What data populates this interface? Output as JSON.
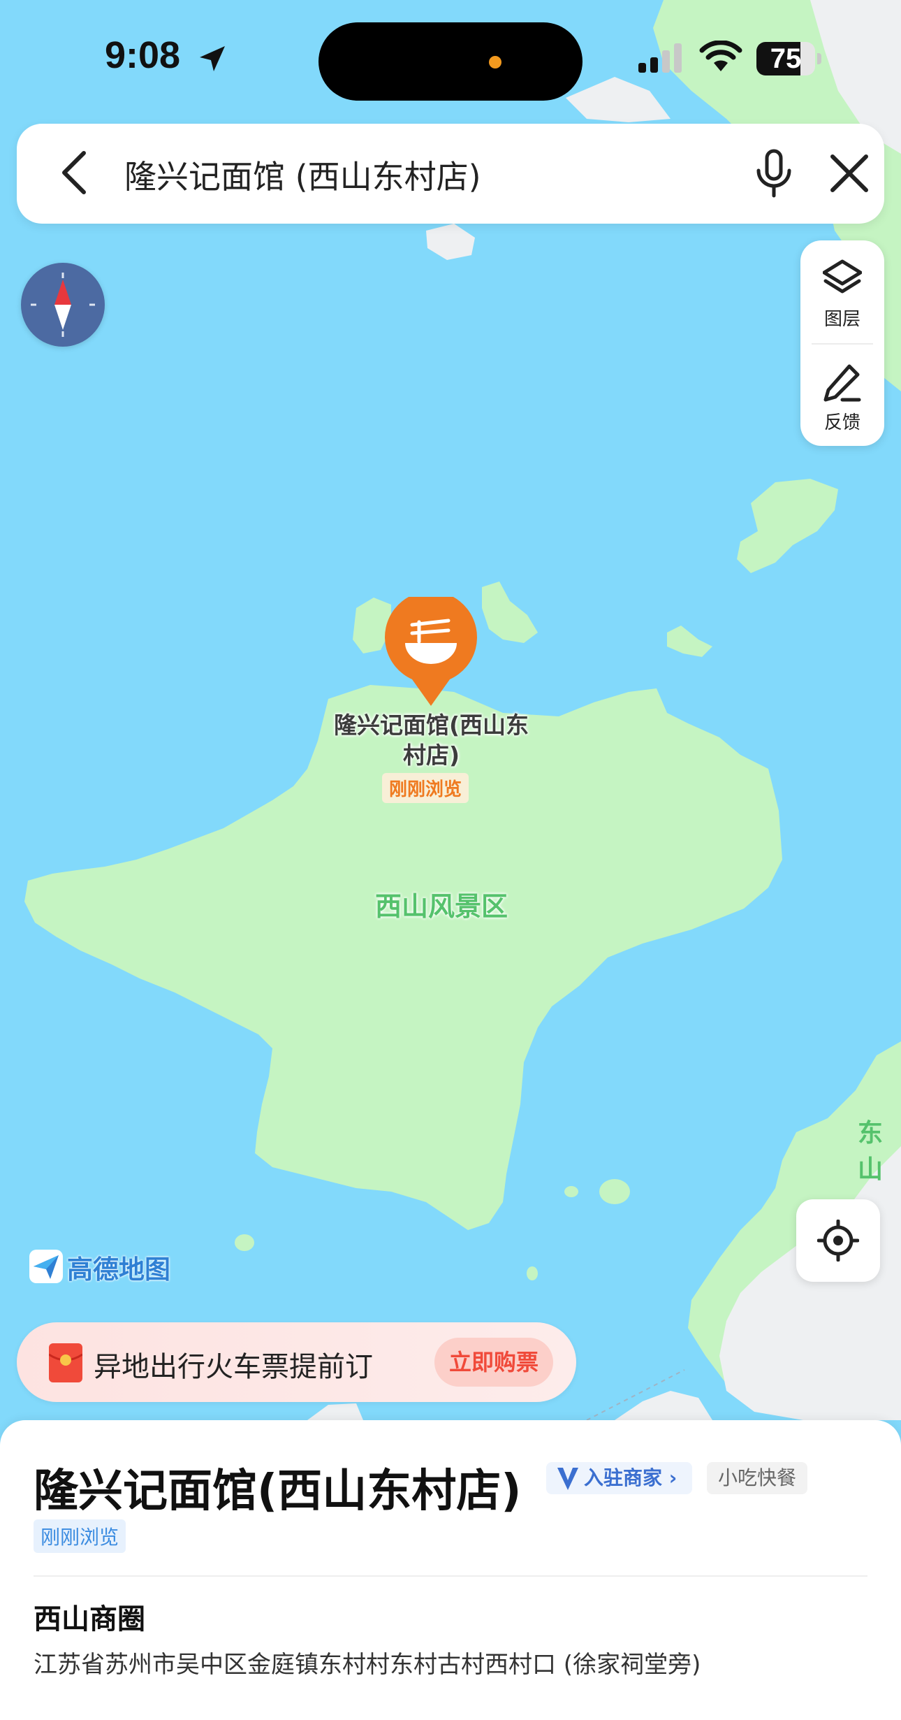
{
  "status_bar": {
    "time": "9:08",
    "battery": "75",
    "battery_level": 0.75
  },
  "search": {
    "query": "隆兴记面馆 (西山东村店)",
    "back_icon": "back-arrow-icon",
    "mic_icon": "microphone-icon",
    "clear_icon": "close-icon"
  },
  "map_tools": {
    "layers_label": "图层",
    "feedback_label": "反馈"
  },
  "map": {
    "poi_name": "隆兴记面馆(西山东村店)",
    "poi_tag": "刚刚浏览",
    "area_label": "西山风景区",
    "area_label_east": "东山",
    "logo_text": "高德地图",
    "colors": {
      "water": "#82d9fb",
      "land": "#c5f4c2",
      "urban": "#eef0f2",
      "poi_marker": "#ef7a20"
    }
  },
  "promo": {
    "text": "异地出行火车票提前订",
    "button_label": "立即购票"
  },
  "place": {
    "title": "隆兴记面馆(西山东村店)",
    "merchant_badge": "入驻商家",
    "category": "小吃快餐",
    "recent_tag": "刚刚浏览",
    "district": "西山商圈",
    "address": "江苏省苏州市吴中区金庭镇东村村东村古村西村口 (徐家祠堂旁)"
  }
}
